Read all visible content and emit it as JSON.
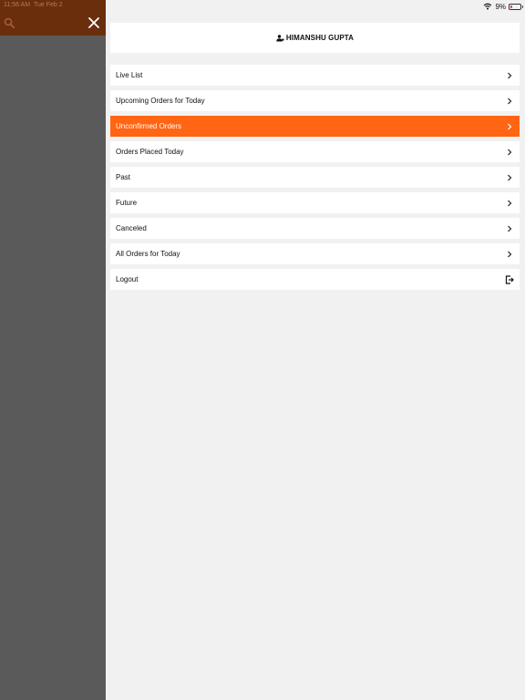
{
  "status_bar": {
    "time": "11:56 AM",
    "date": "Tue Feb 2",
    "battery": "9%",
    "battery_level": 0.09
  },
  "left_panel": {
    "search_icon": "search-icon",
    "close_icon": "close-icon"
  },
  "profile": {
    "name": "HIMANSHU GUPTA",
    "icon": "user-icon"
  },
  "menu": {
    "items": [
      {
        "label": "Live List",
        "active": false,
        "icon": "chevron-right-icon"
      },
      {
        "label": "Upcoming Orders for Today",
        "active": false,
        "icon": "chevron-right-icon"
      },
      {
        "label": "Unconfirmed Orders",
        "active": true,
        "icon": "chevron-right-icon"
      },
      {
        "label": "Orders Placed Today",
        "active": false,
        "icon": "chevron-right-icon"
      },
      {
        "label": "Past",
        "active": false,
        "icon": "chevron-right-icon"
      },
      {
        "label": "Future",
        "active": false,
        "icon": "chevron-right-icon"
      },
      {
        "label": "Canceled",
        "active": false,
        "icon": "chevron-right-icon"
      },
      {
        "label": "All Orders for Today",
        "active": false,
        "icon": "chevron-right-icon"
      },
      {
        "label": "Logout",
        "active": false,
        "icon": "logout-icon"
      }
    ]
  },
  "colors": {
    "accent": "#ff6513",
    "header_dim": "#6b2e0c",
    "overlay": "#5a5a5a",
    "background": "#f1f1f1"
  }
}
